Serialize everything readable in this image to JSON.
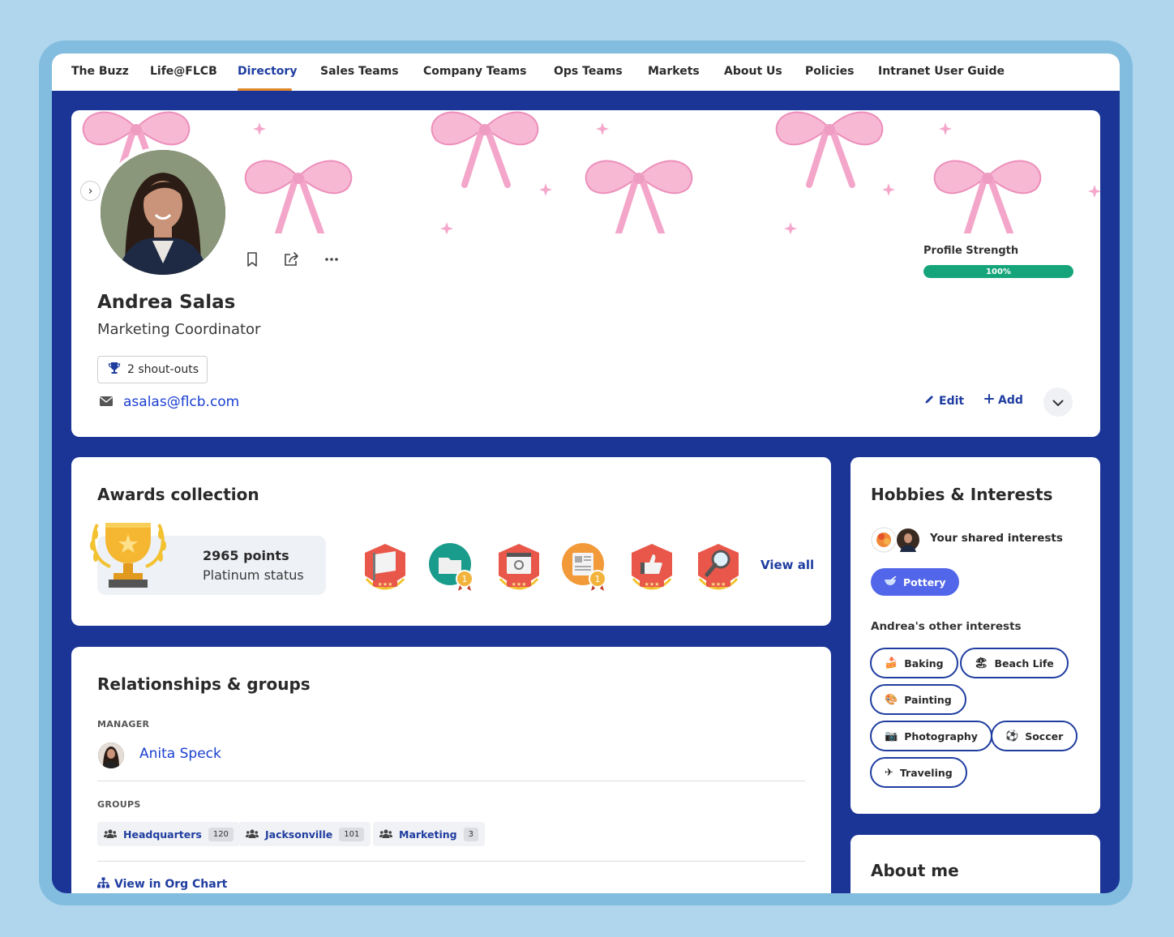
{
  "nav": {
    "items": [
      "The Buzz",
      "Life@FLCB",
      "Directory",
      "Sales Teams",
      "Company Teams",
      "Ops Teams",
      "Markets",
      "About Us",
      "Policies",
      "Intranet User Guide"
    ],
    "active": "Directory"
  },
  "profile": {
    "name": "Andrea Salas",
    "title": "Marketing Coordinator",
    "shoutouts": "2 shout-outs",
    "email": "asalas@flcb.com",
    "strength_label": "Profile Strength",
    "strength_value": 1.0,
    "strength_text": "100%",
    "edit_label": "Edit",
    "add_label": "Add"
  },
  "awards": {
    "heading": "Awards collection",
    "points": "2965 points",
    "status": "Platinum status",
    "view_all": "View all"
  },
  "relationships": {
    "heading": "Relationships & groups",
    "manager_label": "MANAGER",
    "manager_name": "Anita Speck",
    "groups_label": "GROUPS",
    "groups": [
      {
        "name": "Headquarters",
        "count": "120"
      },
      {
        "name": "Jacksonville",
        "count": "101"
      },
      {
        "name": "Marketing",
        "count": "3"
      }
    ],
    "org_chart": "View in Org Chart"
  },
  "hobbies": {
    "heading": "Hobbies & Interests",
    "shared_label": "Your shared interests",
    "shared": [
      "Pottery"
    ],
    "other_label": "Andrea's other interests",
    "other": [
      "Baking",
      "Beach Life",
      "Painting",
      "Photography",
      "Soccer",
      "Traveling"
    ]
  },
  "about": {
    "heading": "About me"
  },
  "colors": {
    "brand_blue": "#1b3597",
    "link_blue": "#1a3fd0",
    "accent_orange": "#e08a2c",
    "success_green": "#16a57a",
    "pill_purple": "#5166e8"
  }
}
